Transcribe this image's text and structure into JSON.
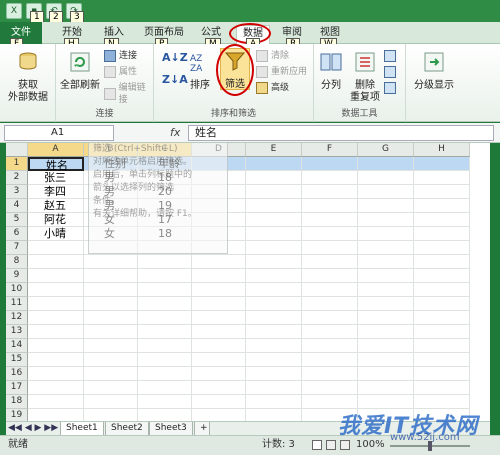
{
  "quick_access": {
    "key_tips": [
      "1",
      "2",
      "3"
    ]
  },
  "tabs": [
    {
      "label": "文件",
      "key": "F"
    },
    {
      "label": "开始",
      "key": "H"
    },
    {
      "label": "插入",
      "key": "N"
    },
    {
      "label": "页面布局",
      "key": "P"
    },
    {
      "label": "公式",
      "key": "M"
    },
    {
      "label": "数据",
      "key": "A"
    },
    {
      "label": "审阅",
      "key": "R"
    },
    {
      "label": "视图",
      "key": "W"
    }
  ],
  "ribbon": {
    "get_external": {
      "label1": "获取",
      "label2": "外部数据"
    },
    "refresh_all": {
      "label": "全部刷新"
    },
    "connections_small": [
      "连接",
      "属性",
      "编辑链接"
    ],
    "connections_title": "连接",
    "sort_title": "排序和筛选",
    "sort_label": "排序",
    "filter_label": "筛选",
    "filter_small": [
      "清除",
      "重新应用",
      "高级"
    ],
    "data_tools_title": "数据工具",
    "split_label": "分列",
    "remove_dup_label1": "删除",
    "remove_dup_label2": "重复项",
    "outline_label": "分级显示"
  },
  "formula_bar": {
    "name_box": "A1",
    "fx": "fx",
    "value": "姓名"
  },
  "columns": [
    "A",
    "B",
    "C",
    "D",
    "E",
    "F",
    "G",
    "H"
  ],
  "rows": [
    "1",
    "2",
    "3",
    "4",
    "5",
    "6",
    "7",
    "8",
    "9",
    "10",
    "11",
    "12",
    "13",
    "14",
    "15",
    "16",
    "17",
    "18",
    "19"
  ],
  "table": [
    [
      "姓名",
      "性别",
      "年龄"
    ],
    [
      "张三",
      "男",
      "18"
    ],
    [
      "李四",
      "男",
      "20"
    ],
    [
      "赵五",
      "男",
      "19"
    ],
    [
      "阿花",
      "女",
      "17"
    ],
    [
      "小晴",
      "女",
      "18"
    ]
  ],
  "tooltip": {
    "title": "筛选 (Ctrl+Shift+L)",
    "line1": "对所选单元格启用筛选。",
    "line2": "启用后，单击列标题中的",
    "line3": "箭头以选择列的筛选",
    "line4": "条件。",
    "help": "有关详细帮助，请按 F1。"
  },
  "sheets": [
    "Sheet1",
    "Sheet2",
    "Sheet3"
  ],
  "status": {
    "mode": "就绪",
    "count": "计数: 3",
    "zoom": "100%"
  },
  "watermark": {
    "title": "我爱IT技术网",
    "url": "www.52ij.com"
  }
}
